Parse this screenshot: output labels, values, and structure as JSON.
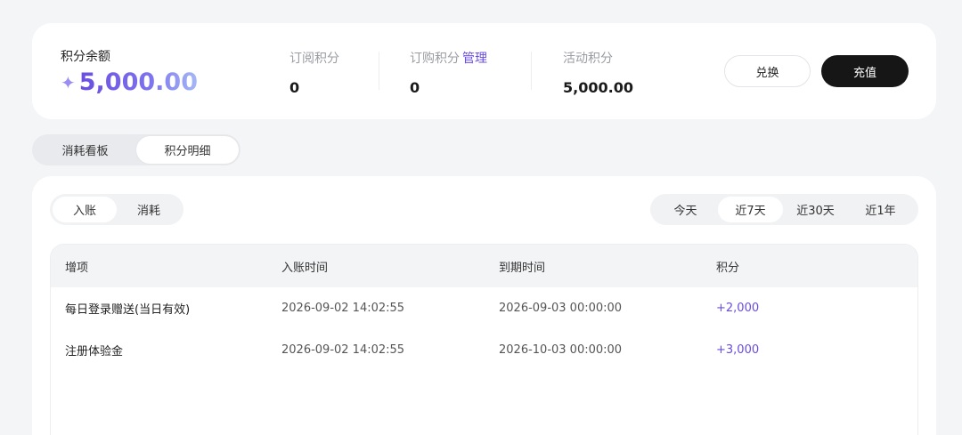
{
  "balance": {
    "label": "积分余额",
    "sparkle": "✦",
    "value": "5,000.00"
  },
  "stats": [
    {
      "label": "订阅积分",
      "value": "0"
    },
    {
      "label": "订购积分",
      "link": "管理",
      "value": "0"
    },
    {
      "label": "活动积分",
      "value": "5,000.00"
    }
  ],
  "buttons": {
    "exchange": "兑换",
    "recharge": "充值"
  },
  "main_tabs": [
    {
      "label": "消耗看板",
      "active": false
    },
    {
      "label": "积分明细",
      "active": true
    }
  ],
  "type_tabs": [
    {
      "label": "入账",
      "active": true
    },
    {
      "label": "消耗",
      "active": false
    }
  ],
  "range_tabs": [
    {
      "label": "今天",
      "active": false
    },
    {
      "label": "近7天",
      "active": true
    },
    {
      "label": "近30天",
      "active": false
    },
    {
      "label": "近1年",
      "active": false
    }
  ],
  "table": {
    "headers": [
      "增项",
      "入账时间",
      "到期时间",
      "积分"
    ],
    "rows": [
      {
        "item": "每日登录赠送(当日有效)",
        "credited": "2026-09-02 14:02:55",
        "expires": "2026-09-03 00:00:00",
        "points": "+2,000"
      },
      {
        "item": "注册体验金",
        "credited": "2026-09-02 14:02:55",
        "expires": "2026-10-03 00:00:00",
        "points": "+3,000"
      }
    ]
  },
  "colors": {
    "accent": "#6a4de0",
    "primary_button": "#161616",
    "background": "#f4f5f7"
  }
}
